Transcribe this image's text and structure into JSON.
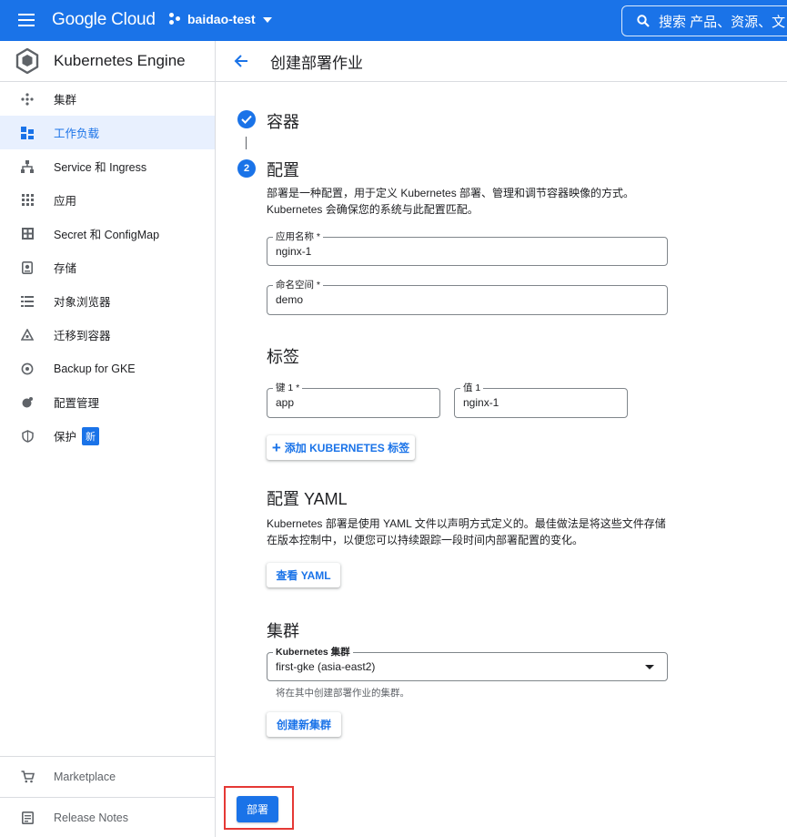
{
  "topbar": {
    "brand": "Google Cloud",
    "project": "baidao-test",
    "search_text": "搜索  产品、资源、文"
  },
  "sidebar": {
    "product_title": "Kubernetes Engine",
    "items": [
      {
        "label": "集群",
        "icon": "cluster-icon"
      },
      {
        "label": "工作负载",
        "icon": "workloads-icon",
        "active": true
      },
      {
        "label": "Service 和 Ingress",
        "icon": "network-icon"
      },
      {
        "label": "应用",
        "icon": "apps-grid-icon"
      },
      {
        "label": "Secret 和 ConfigMap",
        "icon": "config-grid-icon"
      },
      {
        "label": "存储",
        "icon": "storage-icon"
      },
      {
        "label": "对象浏览器",
        "icon": "list-icon"
      },
      {
        "label": "迁移到容器",
        "icon": "migrate-icon"
      },
      {
        "label": "Backup for GKE",
        "icon": "backup-icon"
      },
      {
        "label": "配置管理",
        "icon": "config-management-icon"
      },
      {
        "label": "保护",
        "icon": "shield-icon",
        "badge": "新"
      }
    ],
    "bottom_items": [
      {
        "label": "Marketplace",
        "icon": "cart-icon"
      },
      {
        "label": "Release Notes",
        "icon": "notes-icon"
      }
    ]
  },
  "header": {
    "title": "创建部署作业"
  },
  "stepper": {
    "step1": "容器",
    "step2_number": "2",
    "step2": "配置"
  },
  "config": {
    "desc_line1": "部署是一种配置，用于定义 Kubernetes 部署、管理和调节容器映像的方式。",
    "desc_line2": "Kubernetes 会确保您的系统与此配置匹配。",
    "app_name_label": "应用名称 *",
    "app_name_value": "nginx-1",
    "namespace_label": "命名空间 *",
    "namespace_value": "demo"
  },
  "labels": {
    "title": "标签",
    "key_label": "键 1 *",
    "key_value": "app",
    "value_label": "值 1",
    "value_value": "nginx-1",
    "add_button": "添加 KUBERNETES 标签"
  },
  "yaml": {
    "title": "配置 YAML",
    "desc_line1": "Kubernetes 部署是使用 YAML 文件以声明方式定义的。最佳做法是将这些文件存储",
    "desc_line2": "在版本控制中，以便您可以持续跟踪一段时间内部署配置的变化。",
    "view_button": "查看 YAML"
  },
  "cluster": {
    "title": "集群",
    "select_label": "Kubernetes 集群",
    "select_value": "first-gke (asia-east2)",
    "hint": "将在其中创建部署作业的集群。",
    "create_button": "创建新集群"
  },
  "deploy_button": "部署",
  "colors": {
    "primary": "#1a73e8",
    "highlight": "#e53935",
    "active_bg": "#e8f0fe"
  }
}
